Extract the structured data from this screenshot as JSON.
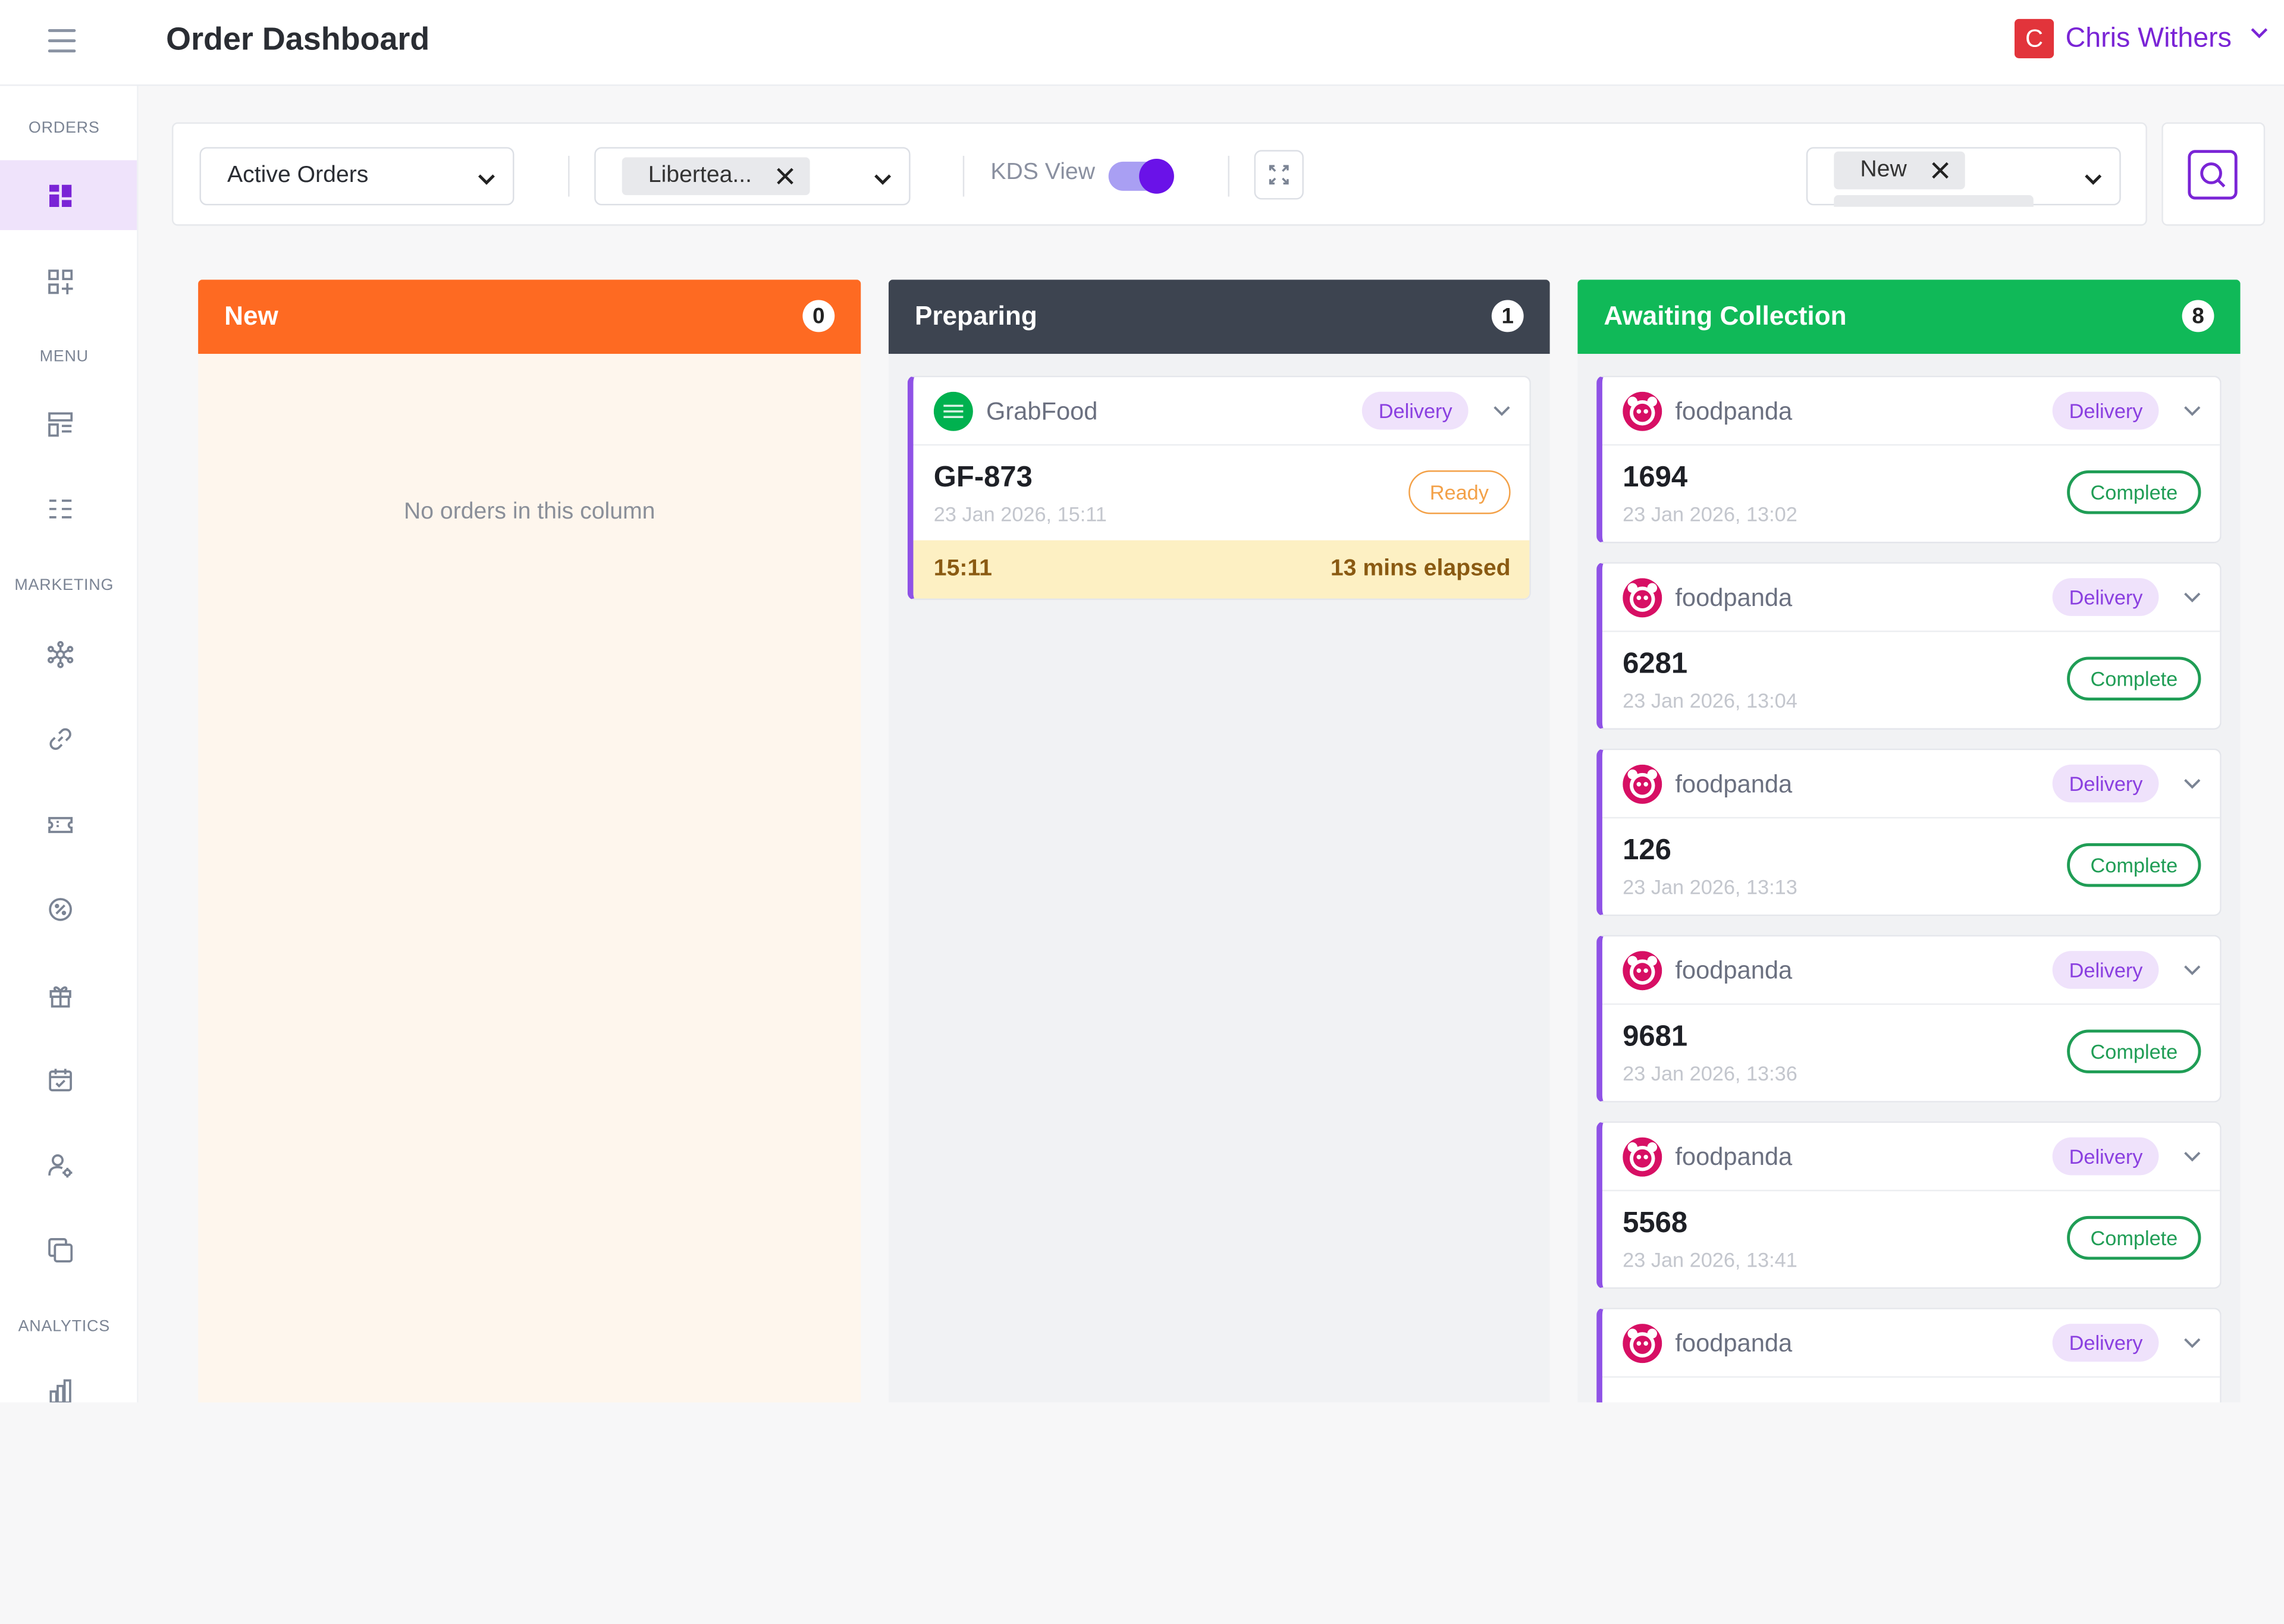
{
  "header": {
    "title": "Order Dashboard",
    "user_initial": "C",
    "user_name": "Chris Withers"
  },
  "sidebar": {
    "sections": [
      "ORDERS",
      "MENU",
      "MARKETING",
      "ANALYTICS"
    ]
  },
  "filters": {
    "view_select": "Active Orders",
    "store_chip": "Libertea...",
    "kds_label": "KDS View",
    "kds_enabled": true,
    "status_chip": "New"
  },
  "columns": [
    {
      "title": "New",
      "count": "0",
      "color": "#fe6a22",
      "body_color": "#fef6ed",
      "empty_message": "No orders in this column"
    },
    {
      "title": "Preparing",
      "count": "1",
      "color": "#3d4450",
      "body_color": "#f1f2f4"
    },
    {
      "title": "Awaiting Collection",
      "count": "8",
      "color": "#10b958",
      "body_color": "#f1f2f4"
    }
  ],
  "preparing_orders": [
    {
      "platform": "GrabFood",
      "type": "Delivery",
      "order_no": "GF-873",
      "time": "23 Jan 2026, 15:11",
      "action": "Ready",
      "elapsed_time": "15:11",
      "elapsed_text": "13 mins elapsed"
    }
  ],
  "awaiting_orders": [
    {
      "platform": "foodpanda",
      "type": "Delivery",
      "order_no": "1694",
      "time": "23 Jan 2026, 13:02",
      "action": "Complete"
    },
    {
      "platform": "foodpanda",
      "type": "Delivery",
      "order_no": "6281",
      "time": "23 Jan 2026, 13:04",
      "action": "Complete"
    },
    {
      "platform": "foodpanda",
      "type": "Delivery",
      "order_no": "126",
      "time": "23 Jan 2026, 13:13",
      "action": "Complete"
    },
    {
      "platform": "foodpanda",
      "type": "Delivery",
      "order_no": "9681",
      "time": "23 Jan 2026, 13:36",
      "action": "Complete"
    },
    {
      "platform": "foodpanda",
      "type": "Delivery",
      "order_no": "5568",
      "time": "23 Jan 2026, 13:41",
      "action": "Complete"
    },
    {
      "platform": "foodpanda",
      "type": "Delivery",
      "order_no": "",
      "time": "",
      "action": ""
    }
  ],
  "colors": {
    "accent": "#7a24d6",
    "grabfood": "#00b14f",
    "foodpanda": "#d70f64"
  }
}
